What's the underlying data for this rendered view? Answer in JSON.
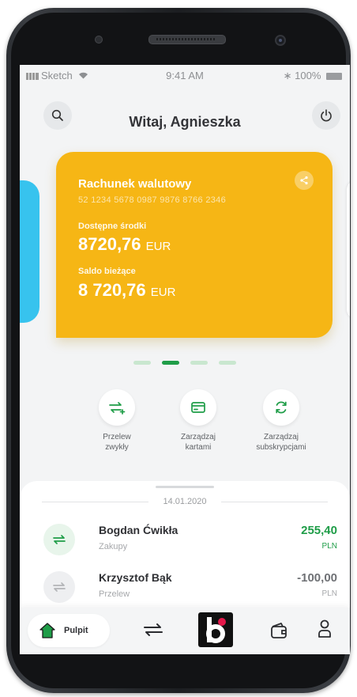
{
  "status_bar": {
    "carrier": "Sketch",
    "time": "9:41 AM",
    "battery": "100%"
  },
  "header": {
    "greeting": "Witaj, Agnieszka",
    "search_icon": "search-icon",
    "power_icon": "power-icon"
  },
  "account_card": {
    "name": "Rachunek walutowy",
    "number": "52 1234 5678 0987 9876 8766 2346",
    "available_label": "Dostępne środki",
    "available_amount": "8720,76",
    "available_currency": "EUR",
    "balance_label": "Saldo bieżące",
    "balance_amount": "8 720,76",
    "balance_currency": "EUR",
    "color": "#f6b615"
  },
  "carousel": {
    "page_count": 4,
    "active_index": 1
  },
  "quick_actions": [
    {
      "label": "Przelew\nzwykły",
      "icon": "transfer-plus-icon"
    },
    {
      "label": "Zarządzaj\nkartami",
      "icon": "card-icon"
    },
    {
      "label": "Zarządzaj\nsubskrypcjami",
      "icon": "refresh-icon"
    }
  ],
  "transactions": {
    "date": "14.01.2020",
    "items": [
      {
        "name": "Bogdan Ćwikła",
        "category": "Zakupy",
        "amount": "255,40",
        "currency": "PLN",
        "type": "incoming"
      },
      {
        "name": "Krzysztof Bąk",
        "category": "Przelew",
        "amount": "-100,00",
        "currency": "PLN",
        "type": "outgoing"
      }
    ]
  },
  "bottom_nav": {
    "home_label": "Pulpit",
    "items": [
      "home-icon",
      "transfers-icon",
      "blik-icon",
      "wallet-icon",
      "profile-icon"
    ]
  },
  "colors": {
    "brand_green": "#1f9d48",
    "income": "#1f9d48",
    "expense": "#8a8c8f",
    "blik_red": "#e5184a"
  }
}
